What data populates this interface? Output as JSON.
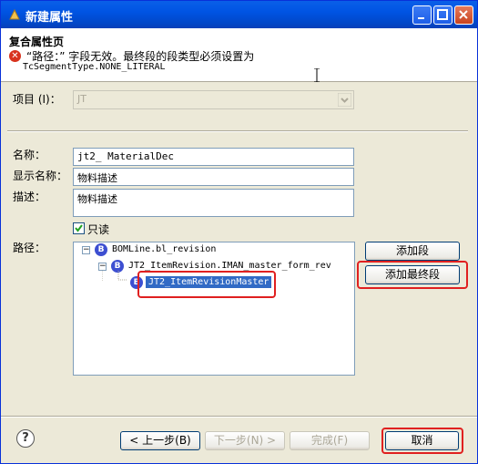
{
  "window": {
    "title": "新建属性"
  },
  "header": {
    "title": "复合属性页",
    "error_line1": "“路径：” 字段无效。最终段的段类型必须设置为",
    "error_line2": "TcSegmentType.NONE_LITERAL"
  },
  "form": {
    "item_label": "项目 (I)：",
    "item_value": "JT",
    "name_label": "名称：",
    "name_value": "jt2_ MaterialDec",
    "display_name_label": "显示名称：",
    "display_name_value": "物料描述",
    "desc_label": "描述：",
    "desc_value": "物料描述",
    "readonly_label": "只读",
    "readonly_checked": true,
    "path_label": "路径："
  },
  "tree": {
    "nodes": [
      {
        "text": "BOMLine.bl_revision",
        "icon": "B",
        "expander": "−"
      },
      {
        "text": "JT2_ItemRevision.IMAN_master_form_rev",
        "icon": "B",
        "expander": "−"
      },
      {
        "text": "JT2_ItemRevisionMaster",
        "icon": "B",
        "selected": true
      }
    ]
  },
  "side_buttons": {
    "add_segment": "添加段",
    "add_final_segment": "添加最终段"
  },
  "footer": {
    "back": "< 上一步(B)",
    "next": "下一步(N) >",
    "finish": "完成(F)",
    "cancel": "取消"
  },
  "colors": {
    "title_bar": "#0054e3",
    "highlight": "#e02020",
    "selection": "#316ac5",
    "error": "#d8321d"
  }
}
